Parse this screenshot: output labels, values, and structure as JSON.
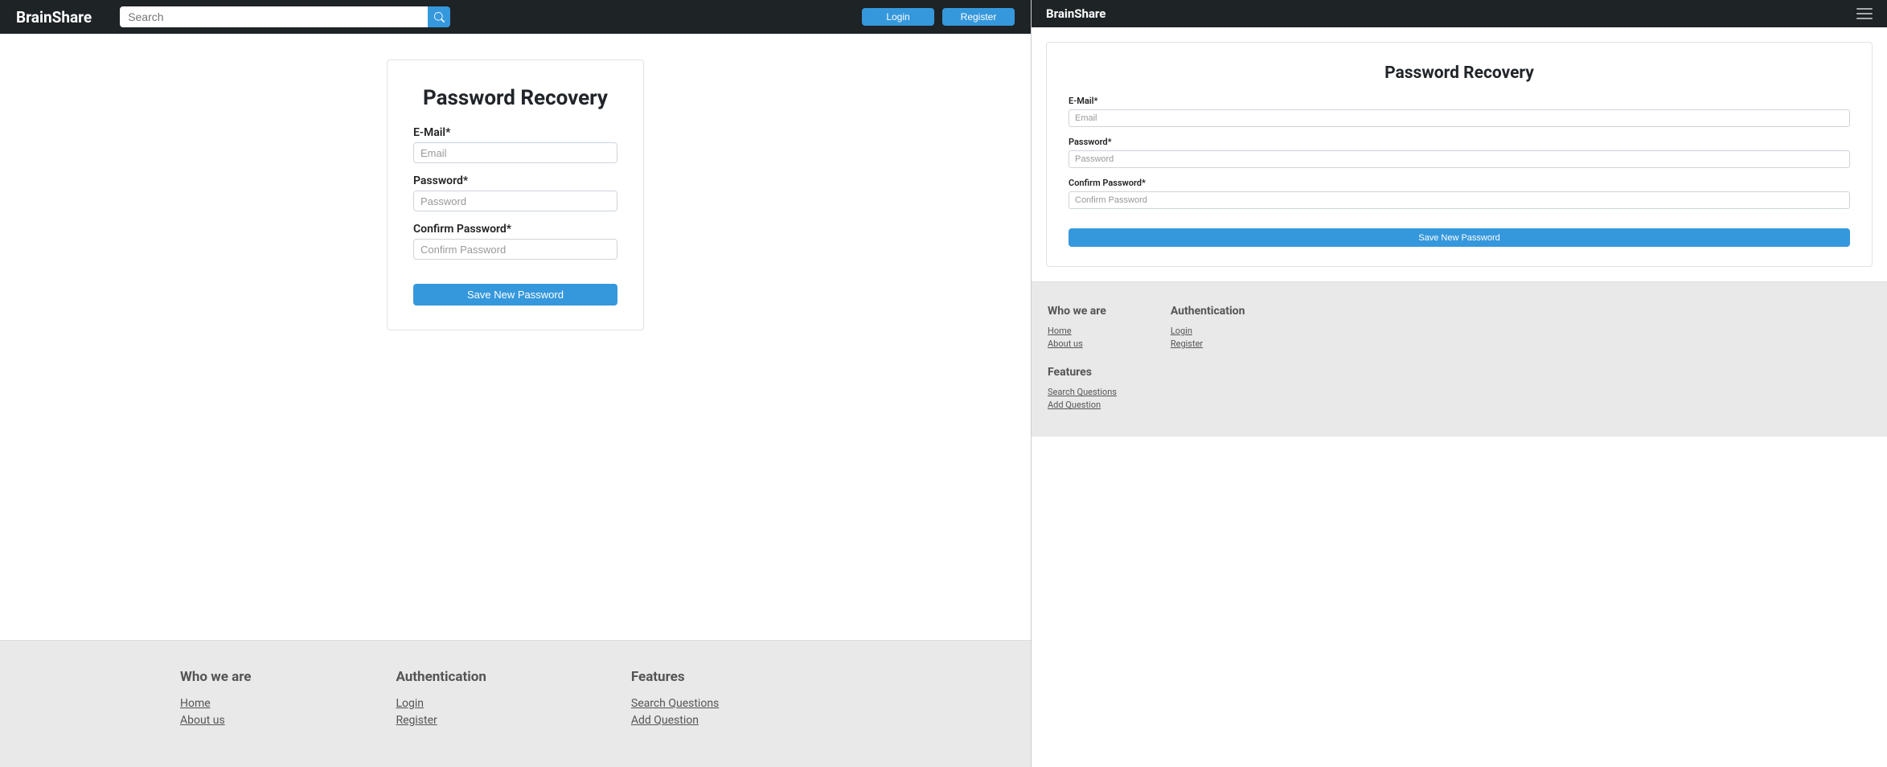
{
  "brand": "BrainShare",
  "search": {
    "placeholder": "Search"
  },
  "nav": {
    "login": "Login",
    "register": "Register"
  },
  "card": {
    "title": "Password Recovery",
    "email_label": "E-Mail*",
    "email_placeholder": "Email",
    "password_label": "Password*",
    "password_placeholder": "Password",
    "confirm_label": "Confirm Password*",
    "confirm_placeholder": "Confirm Password",
    "submit": "Save New Password"
  },
  "footer": {
    "who": {
      "title": "Who we are",
      "home": "Home",
      "about": "About us"
    },
    "auth": {
      "title": "Authentication",
      "login": "Login",
      "register": "Register"
    },
    "features": {
      "title": "Features",
      "search": "Search Questions",
      "add": "Add Question"
    }
  }
}
